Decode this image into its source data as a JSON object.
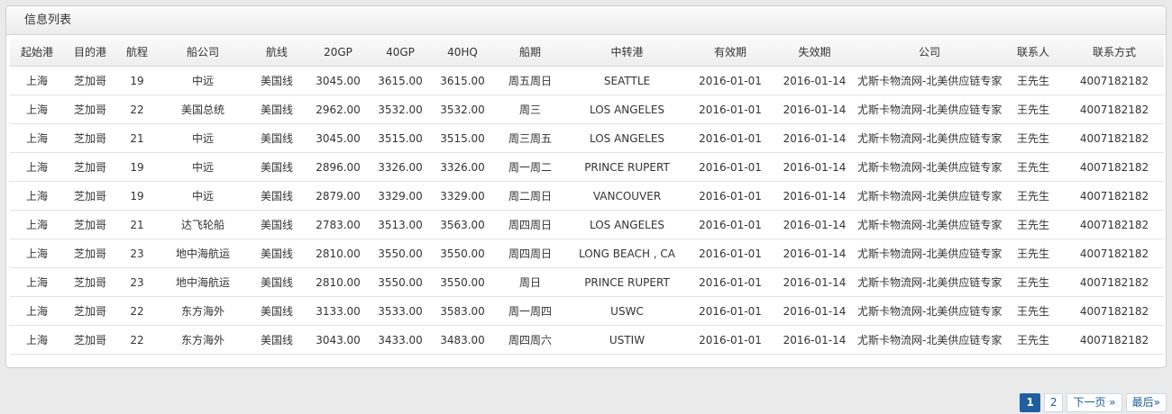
{
  "panel": {
    "title": "信息列表"
  },
  "columns": [
    "起始港",
    "目的港",
    "航程",
    "船公司",
    "航线",
    "20GP",
    "40GP",
    "40HQ",
    "船期",
    "中转港",
    "有效期",
    "失效期",
    "公司",
    "联系人",
    "联系方式"
  ],
  "rows": [
    [
      "上海",
      "芝加哥",
      "19",
      "中远",
      "美国线",
      "3045.00",
      "3615.00",
      "3615.00",
      "周五周日",
      "SEATTLE",
      "2016-01-01",
      "2016-01-14",
      "尤斯卡物流网-北美供应链专家",
      "王先生",
      "4007182182"
    ],
    [
      "上海",
      "芝加哥",
      "22",
      "美国总统",
      "美国线",
      "2962.00",
      "3532.00",
      "3532.00",
      "周三",
      "LOS ANGELES",
      "2016-01-01",
      "2016-01-14",
      "尤斯卡物流网-北美供应链专家",
      "王先生",
      "4007182182"
    ],
    [
      "上海",
      "芝加哥",
      "21",
      "中远",
      "美国线",
      "3045.00",
      "3515.00",
      "3515.00",
      "周三周五",
      "LOS ANGELES",
      "2016-01-01",
      "2016-01-14",
      "尤斯卡物流网-北美供应链专家",
      "王先生",
      "4007182182"
    ],
    [
      "上海",
      "芝加哥",
      "19",
      "中远",
      "美国线",
      "2896.00",
      "3326.00",
      "3326.00",
      "周一周二",
      "PRINCE RUPERT",
      "2016-01-01",
      "2016-01-14",
      "尤斯卡物流网-北美供应链专家",
      "王先生",
      "4007182182"
    ],
    [
      "上海",
      "芝加哥",
      "19",
      "中远",
      "美国线",
      "2879.00",
      "3329.00",
      "3329.00",
      "周二周日",
      "VANCOUVER",
      "2016-01-01",
      "2016-01-14",
      "尤斯卡物流网-北美供应链专家",
      "王先生",
      "4007182182"
    ],
    [
      "上海",
      "芝加哥",
      "21",
      "达飞轮船",
      "美国线",
      "2783.00",
      "3513.00",
      "3563.00",
      "周四周日",
      "LOS ANGELES",
      "2016-01-01",
      "2016-01-14",
      "尤斯卡物流网-北美供应链专家",
      "王先生",
      "4007182182"
    ],
    [
      "上海",
      "芝加哥",
      "23",
      "地中海航运",
      "美国线",
      "2810.00",
      "3550.00",
      "3550.00",
      "周四周日",
      "LONG BEACH , CA",
      "2016-01-01",
      "2016-01-14",
      "尤斯卡物流网-北美供应链专家",
      "王先生",
      "4007182182"
    ],
    [
      "上海",
      "芝加哥",
      "23",
      "地中海航运",
      "美国线",
      "2810.00",
      "3550.00",
      "3550.00",
      "周日",
      "PRINCE RUPERT",
      "2016-01-01",
      "2016-01-14",
      "尤斯卡物流网-北美供应链专家",
      "王先生",
      "4007182182"
    ],
    [
      "上海",
      "芝加哥",
      "22",
      "东方海外",
      "美国线",
      "3133.00",
      "3533.00",
      "3583.00",
      "周一周四",
      "USWC",
      "2016-01-01",
      "2016-01-14",
      "尤斯卡物流网-北美供应链专家",
      "王先生",
      "4007182182"
    ],
    [
      "上海",
      "芝加哥",
      "22",
      "东方海外",
      "美国线",
      "3043.00",
      "3433.00",
      "3483.00",
      "周四周六",
      "USTIW",
      "2016-01-01",
      "2016-01-14",
      "尤斯卡物流网-北美供应链专家",
      "王先生",
      "4007182182"
    ]
  ],
  "pagination": {
    "page1": "1",
    "page2": "2",
    "next": "下一页 »",
    "last": "最后»"
  },
  "colors": {
    "accent": "#1f5fa0",
    "link": "#1a5c99"
  }
}
